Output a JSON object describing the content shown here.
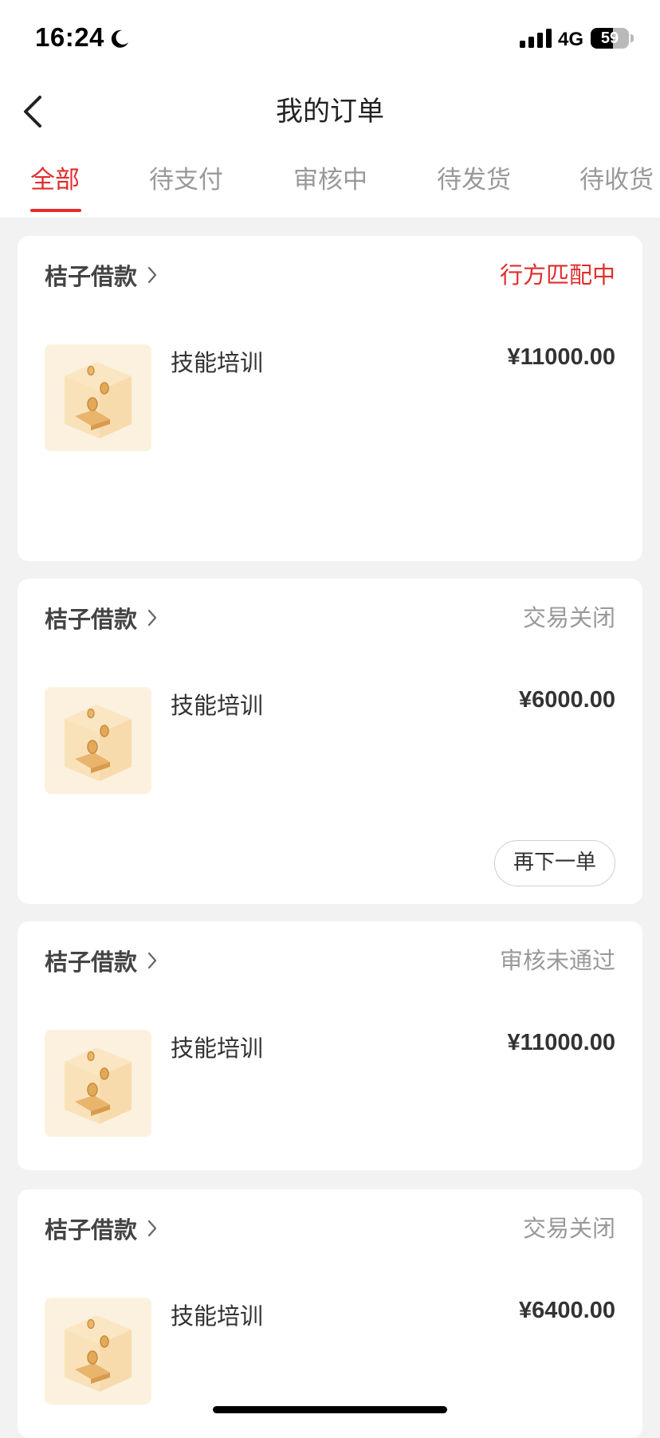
{
  "status_bar": {
    "time": "16:24",
    "network": "4G",
    "battery": "59",
    "battery_level": 0.59
  },
  "nav": {
    "title": "我的订单"
  },
  "tabs": [
    {
      "label": "全部",
      "active": true
    },
    {
      "label": "待支付",
      "active": false
    },
    {
      "label": "审核中",
      "active": false
    },
    {
      "label": "待发货",
      "active": false
    },
    {
      "label": "待收货",
      "active": false
    }
  ],
  "orders": [
    {
      "shop": "桔子借款",
      "status": "行方匹配中",
      "item": "技能培训",
      "price": "¥11000.00"
    },
    {
      "shop": "桔子借款",
      "status": "交易关闭",
      "item": "技能培训",
      "price": "¥6000.00",
      "action": "再下一单"
    },
    {
      "shop": "桔子借款",
      "status": "审核未通过",
      "item": "技能培训",
      "price": "¥11000.00"
    },
    {
      "shop": "桔子借款",
      "status": "交易关闭",
      "item": "技能培训",
      "price": "¥6400.00"
    }
  ],
  "colors": {
    "accent": "#e02e2e",
    "background": "#f2f2f2",
    "card": "#ffffff",
    "muted": "#999999"
  }
}
